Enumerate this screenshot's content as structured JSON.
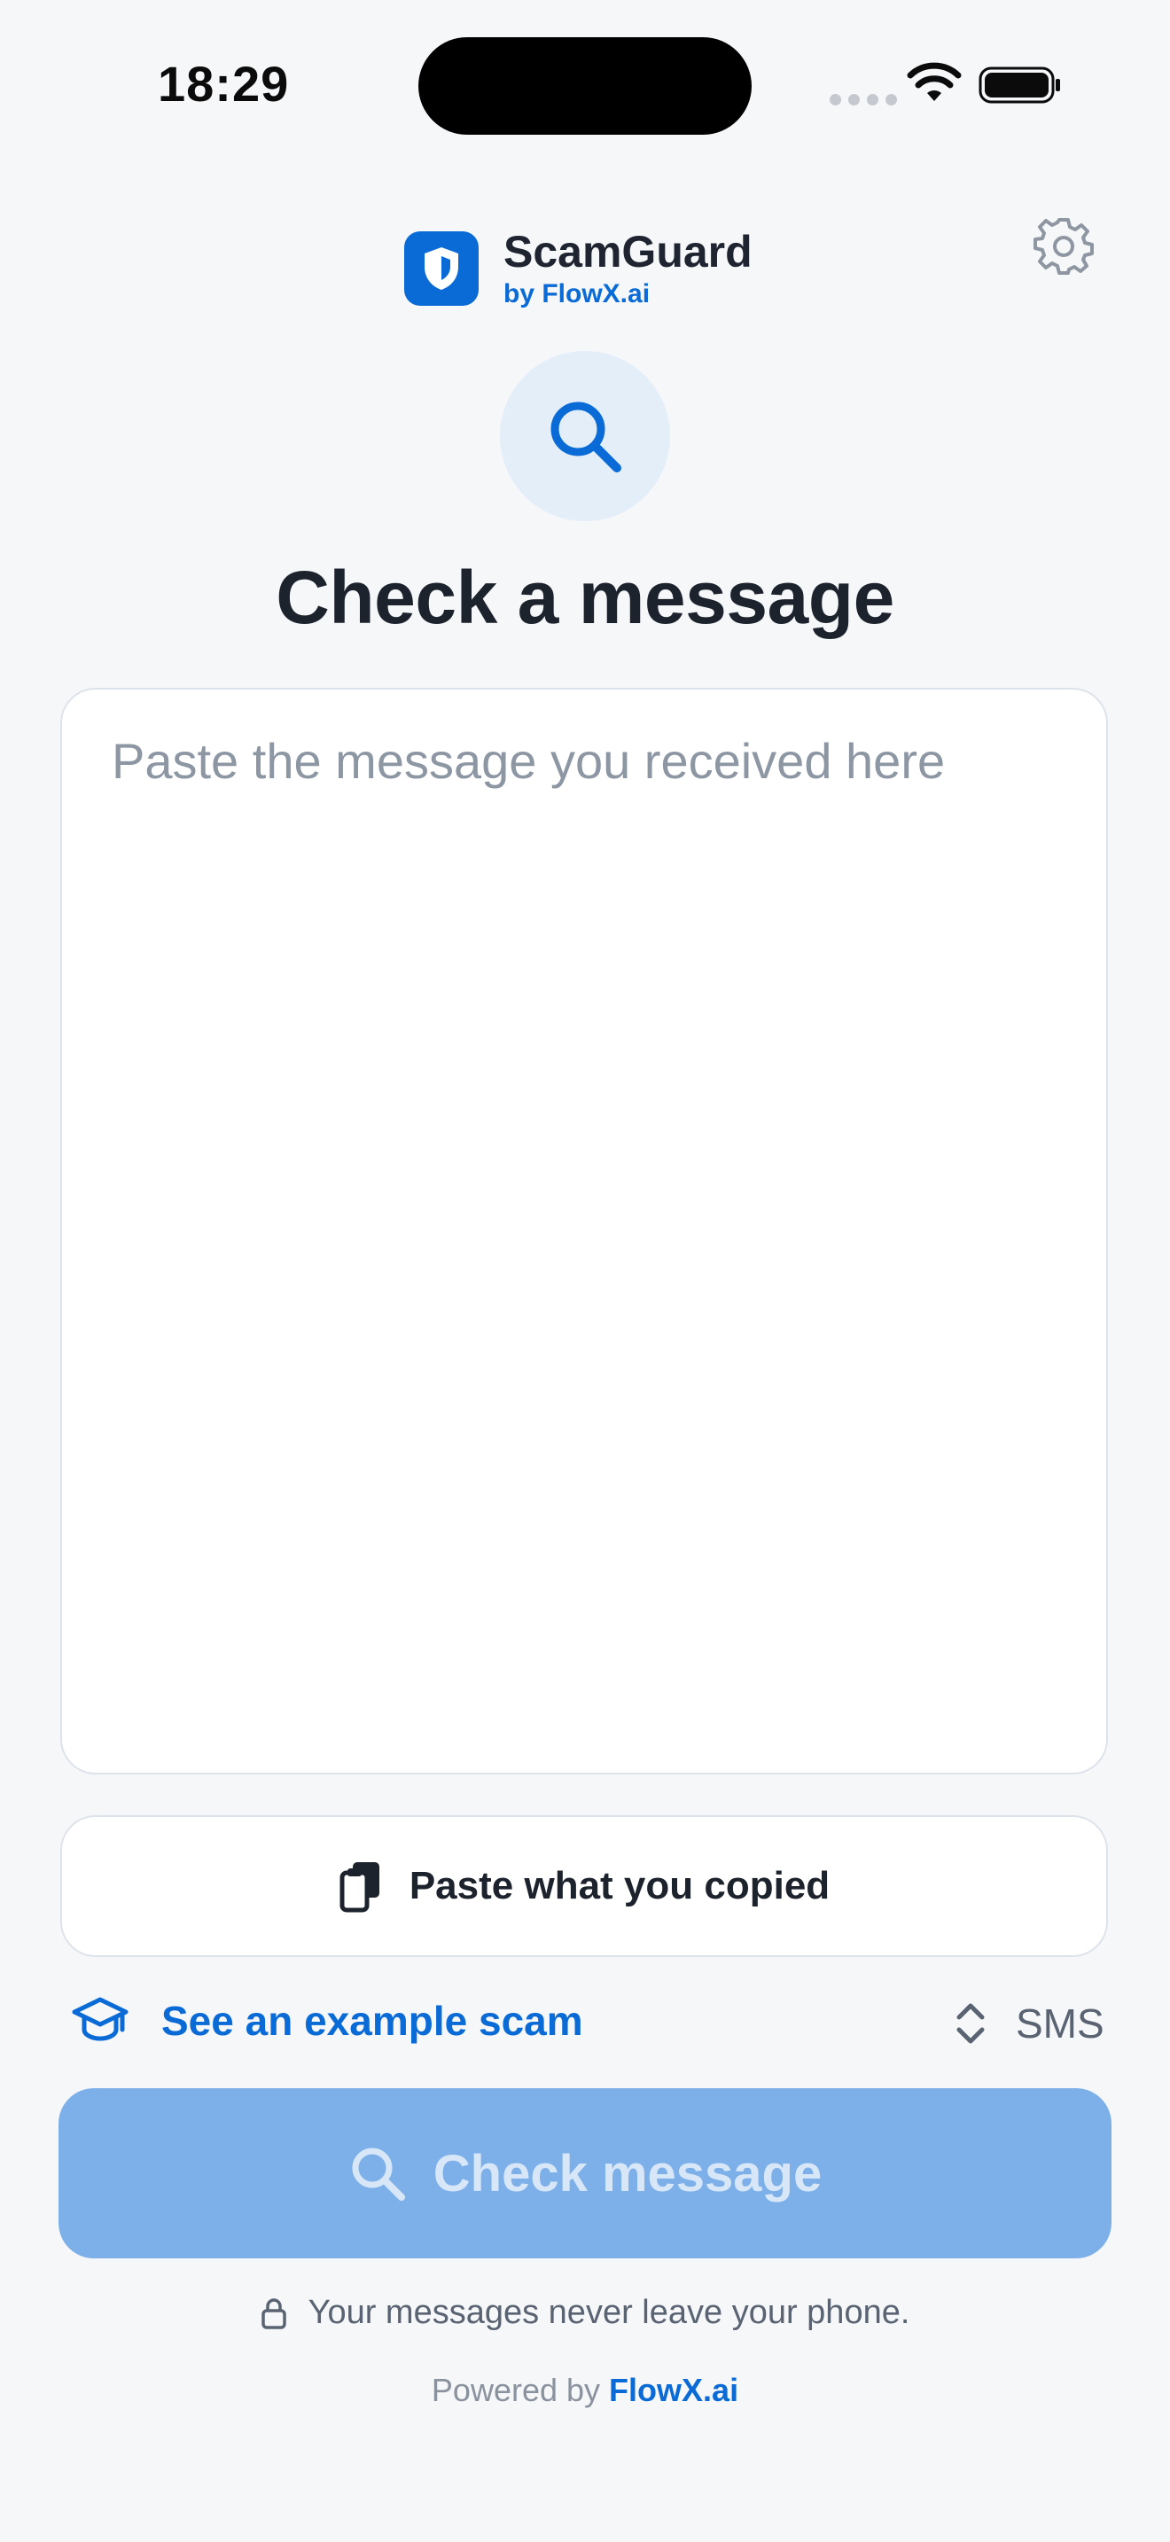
{
  "status_bar": {
    "time": "18:29"
  },
  "header": {
    "app_name": "ScamGuard",
    "byline": "by FlowX.ai"
  },
  "main": {
    "title": "Check a message",
    "input_placeholder": "Paste the message you received here",
    "paste_button_label": "Paste what you copied",
    "example_link_label": "See an example scam",
    "message_type_value": "SMS",
    "check_button_label": "Check message",
    "privacy_note": "Your messages never leave your phone."
  },
  "footer": {
    "powered_prefix": "Powered by",
    "powered_link": "FlowX.ai"
  },
  "colors": {
    "brand": "#0a6ad6",
    "background": "#f5f7f9",
    "check_button_disabled": "#7db0e8"
  },
  "icons": [
    "shield-icon",
    "gear-icon",
    "search-icon",
    "clipboard-icon",
    "graduation-cap-icon",
    "chevron-up-down-icon",
    "lock-icon",
    "wifi-icon",
    "battery-icon"
  ]
}
